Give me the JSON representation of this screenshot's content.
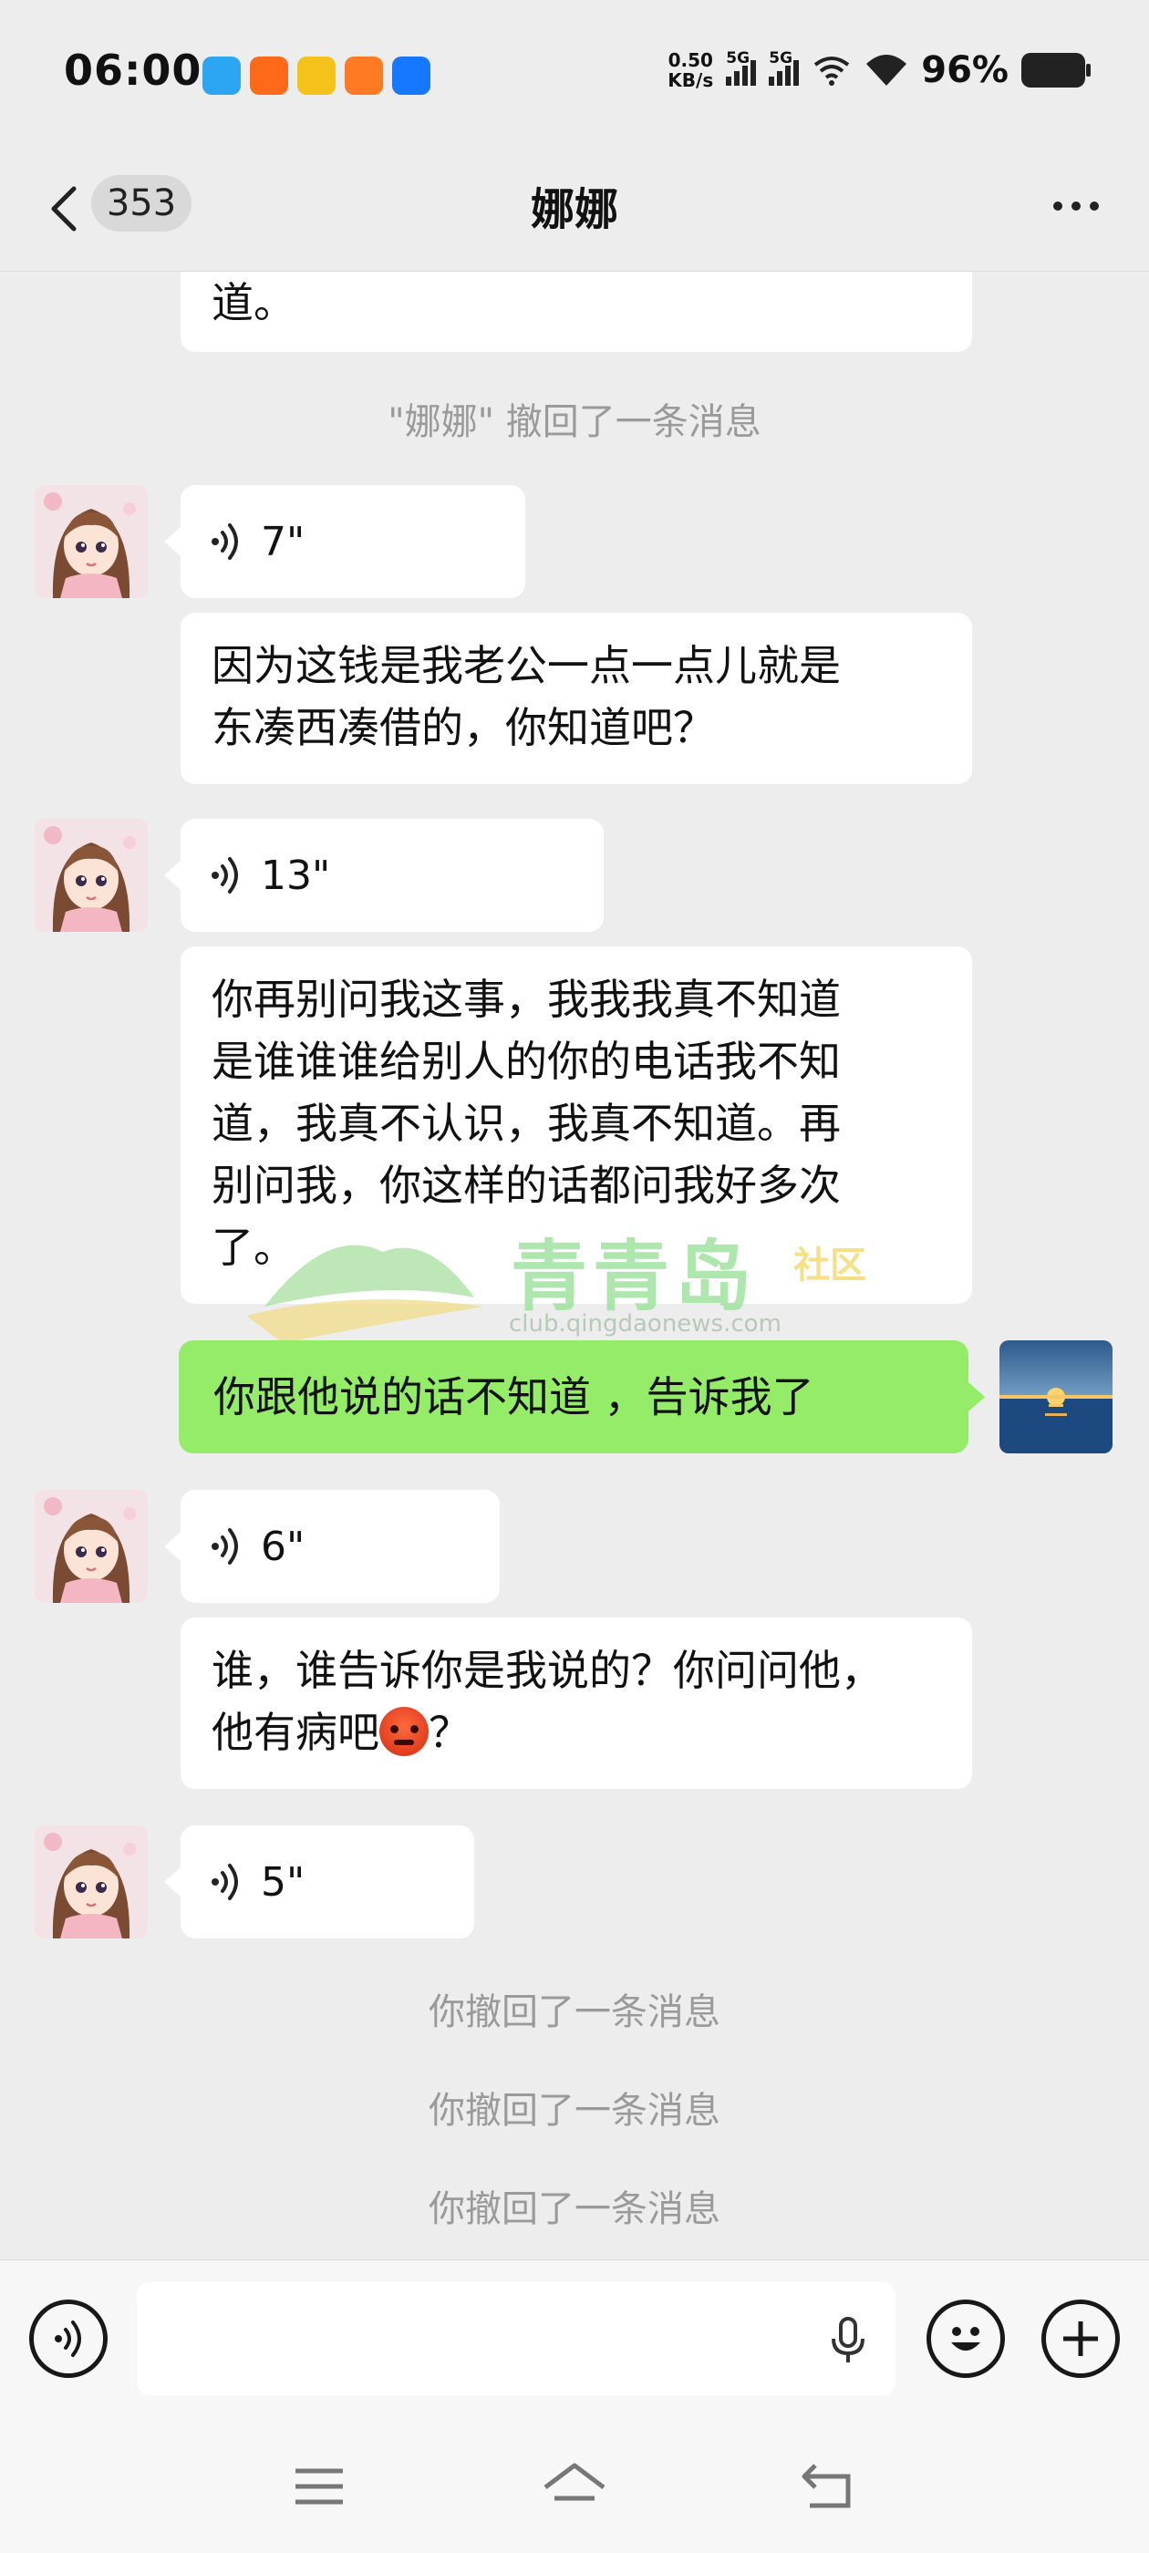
{
  "status_bar": {
    "time": "06:00",
    "net_speed_value": "0.50",
    "net_speed_unit": "KB/s",
    "signal_1_label": "5G",
    "signal_2_label": "5G",
    "battery": "96%",
    "app_icons": [
      "weather-app-icon",
      "video-app-icon",
      "game-app-icon",
      "video-app-icon-2",
      "news-app-icon"
    ]
  },
  "header": {
    "unread_count": "353",
    "contact_name": "娜娜"
  },
  "messages": {
    "m0_text": "道。",
    "m1_recall": "\"娜娜\" 撤回了一条消息",
    "m2_voice": "7\"",
    "m3_line1": "因为这钱是我老公一点一点儿就是",
    "m3_line2": "东凑西凑借的，你知道吧？",
    "m4_voice": "13\"",
    "m5_line1": "你再别问我这事，我我我真不知道",
    "m5_line2": "是谁谁谁给别人的你的电话我不知",
    "m5_line3": "道，我真不认识，我真不知道。再",
    "m5_line4": "别问我，你这样的话都问我好多次",
    "m5_line5": "了。",
    "m6_text": "你跟他说的话不知道 ，告诉我了",
    "m7_voice": "6\"",
    "m8_line1": "谁，谁告诉你是我说的？你问问他，",
    "m8_line2a": "他有病吧",
    "m8_line2b": "？",
    "m9_voice": "5\"",
    "m10_recall": "你撤回了一条消息",
    "m11_recall": "你撤回了一条消息",
    "m12_recall": "你撤回了一条消息"
  },
  "watermark": {
    "brand": "青青岛",
    "tag": "社区",
    "url": "club.qingdaonews.com"
  },
  "colors": {
    "background": "#ededed",
    "bubble_self": "#95ec69",
    "bubble_other": "#ffffff",
    "system_text": "#9a9a9a"
  }
}
